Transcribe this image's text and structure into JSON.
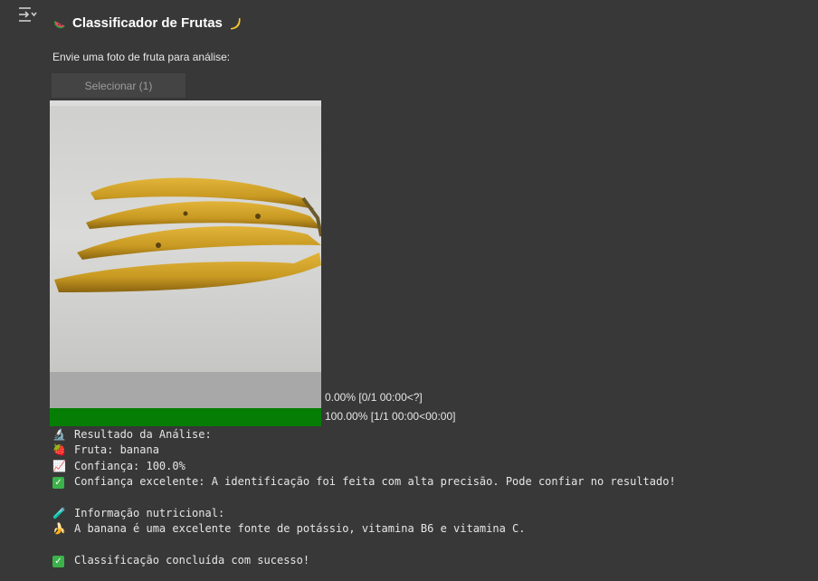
{
  "header": {
    "title": "Classificador de Frutas",
    "title_icon_left": "watermelon-icon",
    "title_icon_right": "banana-icon"
  },
  "upload": {
    "prompt": "Envie uma foto de fruta para análise:",
    "button_label": "Selecionar (1)"
  },
  "image": {
    "subject": "banana-photo"
  },
  "progress": [
    {
      "text": "0.00% [0/1 00:00<?]",
      "fraction": 0.0
    },
    {
      "text": "100.00% [1/1 00:00<00:00]",
      "fraction": 1.0
    }
  ],
  "result": {
    "heading": "Resultado da Análise:",
    "fruit": "Fruta: banana",
    "confidence": "Confiança: 100.0%",
    "confidence_note": "Confiança excelente: A identificação foi feita com alta precisão. Pode confiar no resultado!",
    "nutrition_heading": "Informação nutricional:",
    "nutrition_text": "A banana é uma excelente fonte de potássio, vitamina B6 e vitamina C.",
    "done": "Classificação concluída com sucesso!"
  },
  "icons": {
    "heading": "microscope-icon",
    "fruit": "strawberry-icon",
    "confidence": "chart-increasing-icon",
    "confidence_note": "check-mark-icon",
    "nutrition": "test-tube-icon",
    "nutrition_text": "banana-icon",
    "done": "check-mark-icon"
  },
  "colors": {
    "background": "#383838",
    "progress_complete": "#067d05",
    "progress_empty": "#a8a8a8",
    "check": "#3bb34a"
  }
}
